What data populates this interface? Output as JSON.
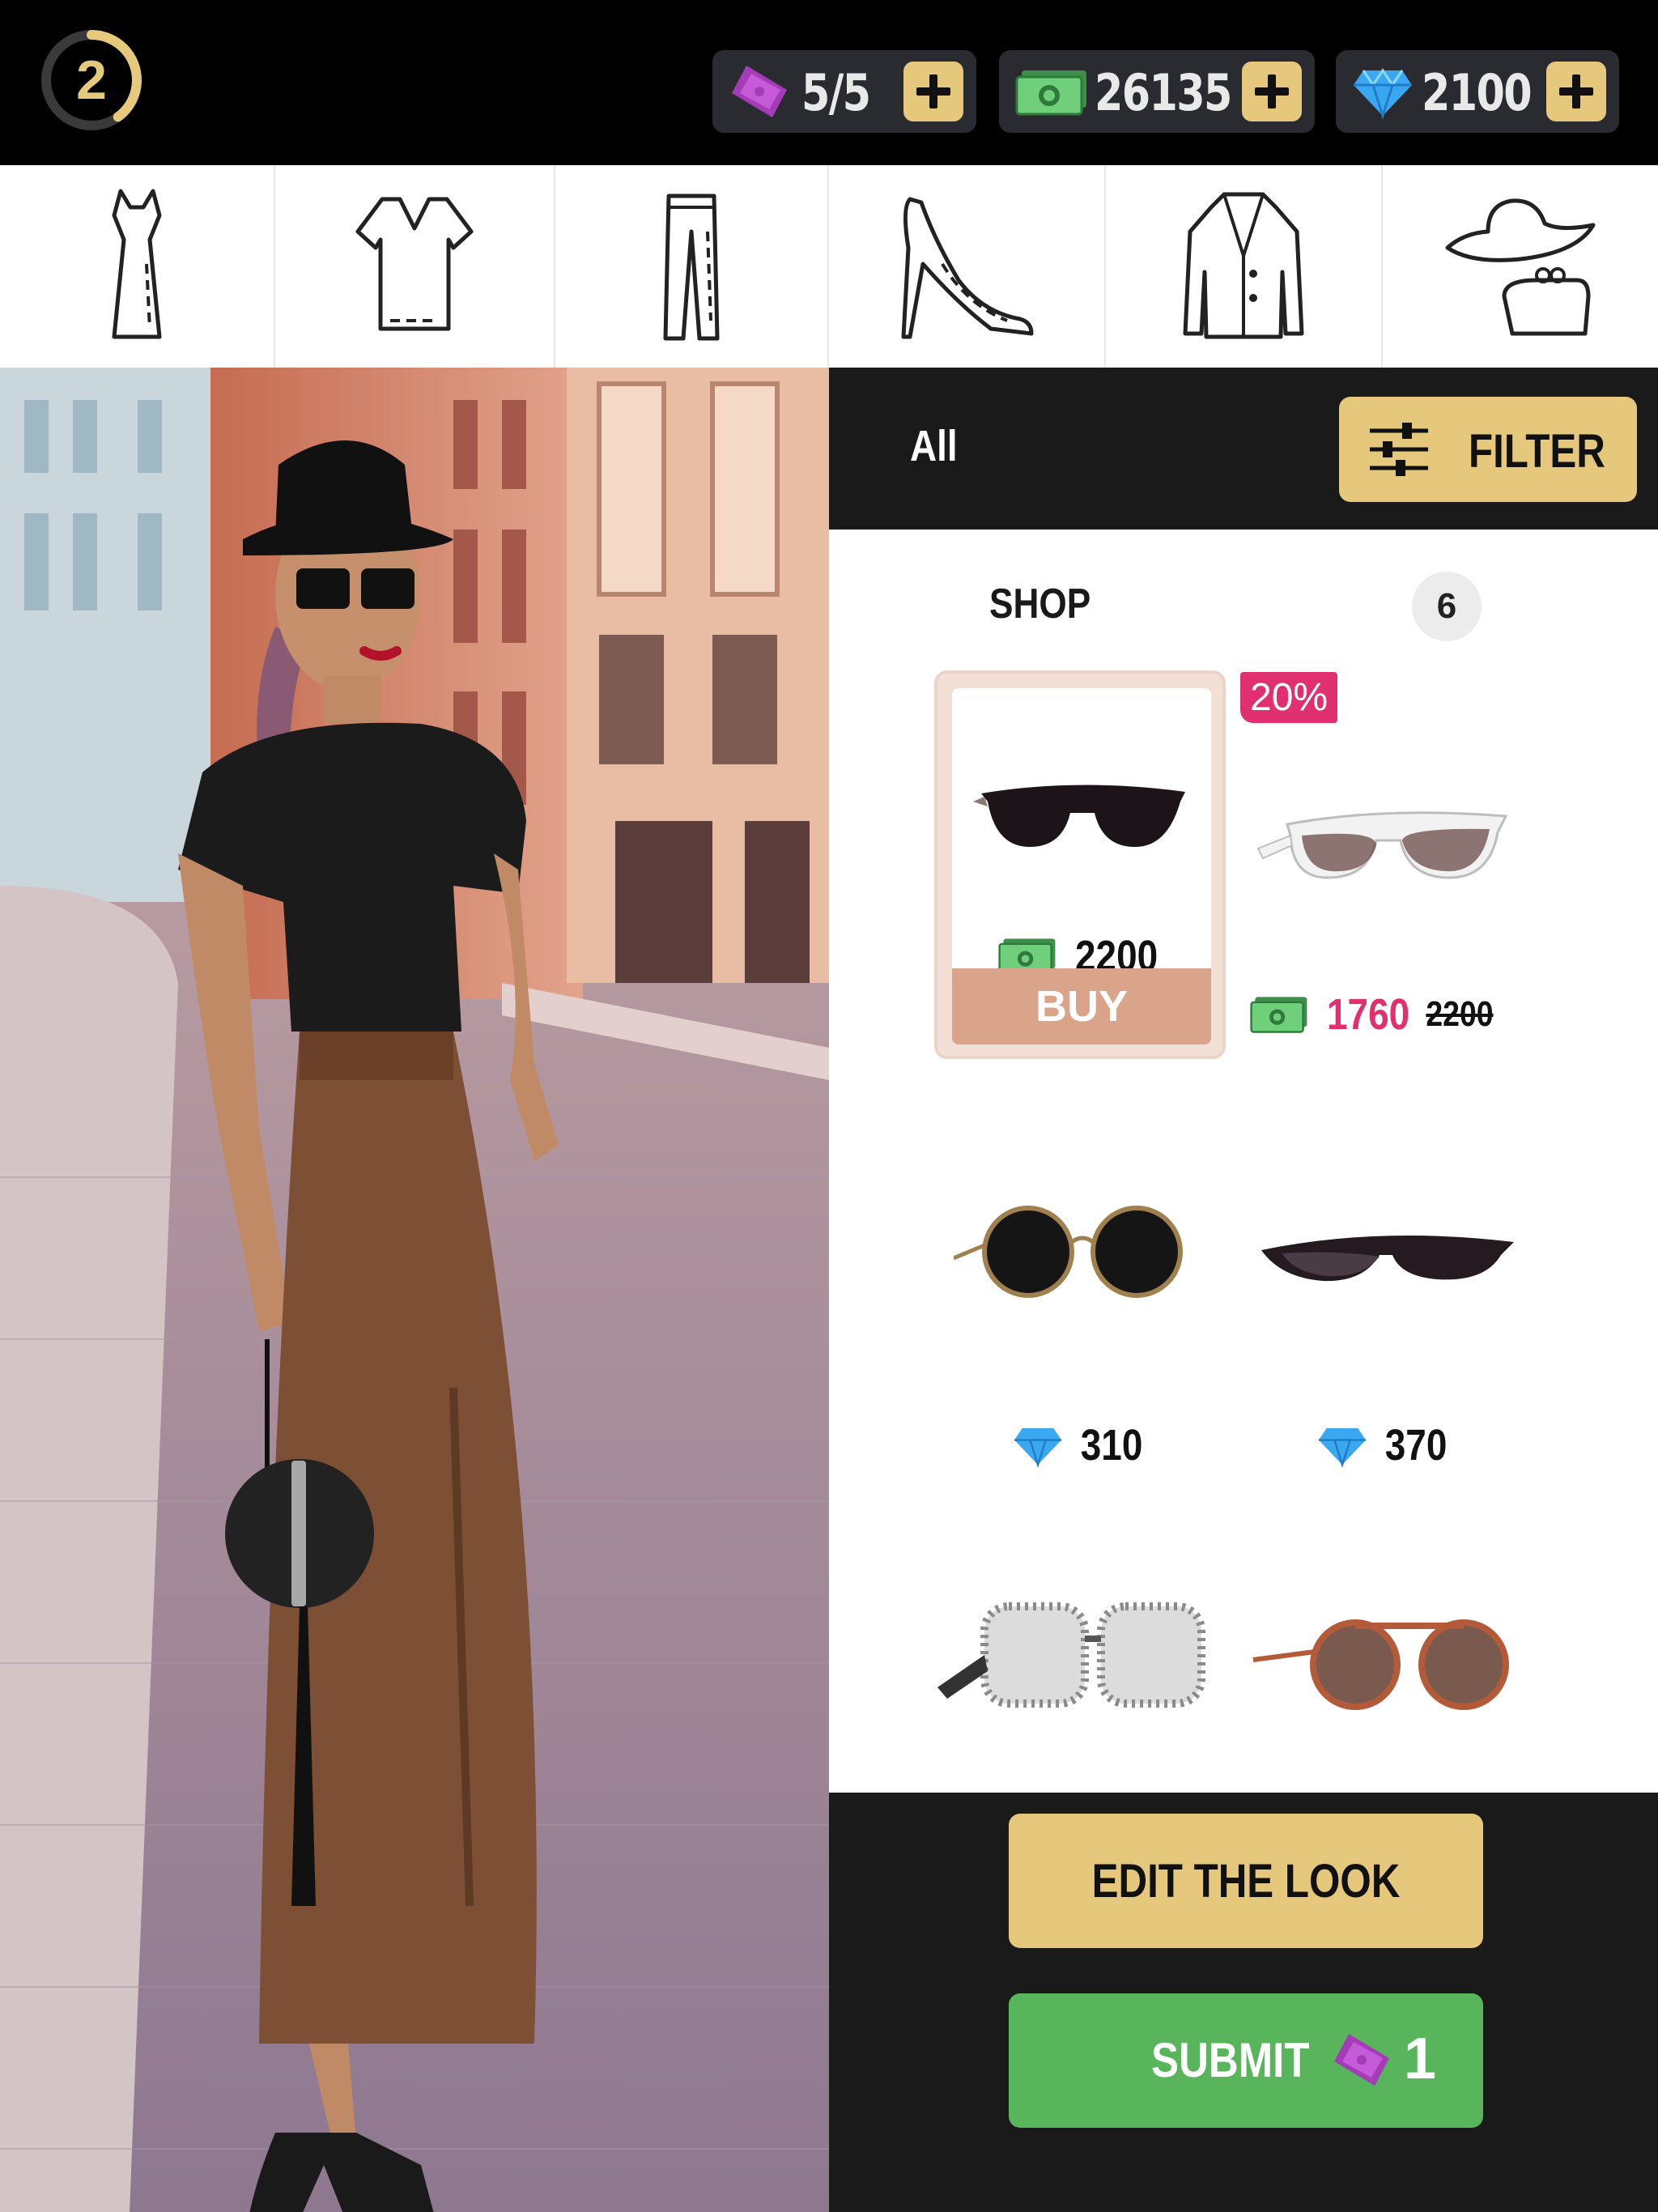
{
  "topbar": {
    "level": "2",
    "level_progress": 0.4,
    "tickets": "5/5",
    "cash": "26135",
    "diamonds": "2100",
    "icons": [
      "ticket-icon",
      "cash-icon",
      "diamond-icon",
      "plus-icon"
    ]
  },
  "categories": [
    {
      "name": "dress"
    },
    {
      "name": "top"
    },
    {
      "name": "pants"
    },
    {
      "name": "shoes"
    },
    {
      "name": "coat"
    },
    {
      "name": "accessories"
    }
  ],
  "panel": {
    "filter_scope": "All",
    "filter_label": "FILTER",
    "section_label": "SHOP",
    "section_count": "6"
  },
  "items": [
    {
      "price": "2200",
      "currency": "cash",
      "buy_label": "BUY"
    },
    {
      "badge": "20%",
      "price": "1760",
      "old_price": "2200",
      "currency": "cash"
    },
    {
      "price": "310",
      "currency": "diamond"
    },
    {
      "price": "370",
      "currency": "diamond"
    },
    {
      "price": "",
      "currency": ""
    },
    {
      "price": "",
      "currency": ""
    }
  ],
  "actions": {
    "edit_label": "EDIT THE LOOK",
    "submit_label": "SUBMIT",
    "submit_cost": "1"
  },
  "colors": {
    "accent": "#e6c87c",
    "submit": "#59b55b",
    "sale": "#e0306f",
    "buy": "#d9a48a"
  }
}
